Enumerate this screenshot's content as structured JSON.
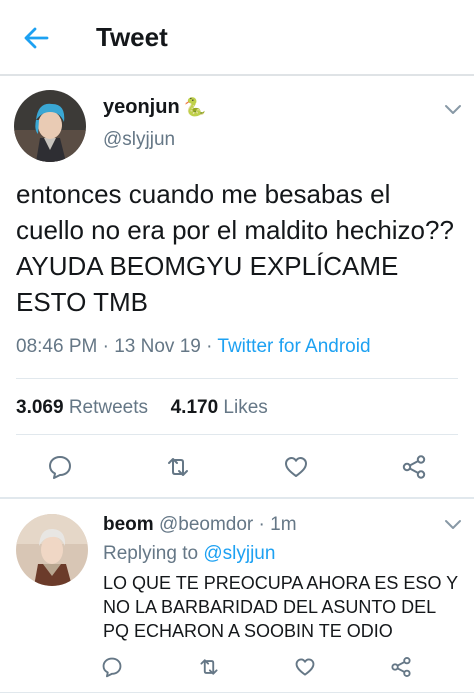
{
  "header": {
    "title": "Tweet"
  },
  "tweet": {
    "display_name": "yeonjun",
    "name_emoji": "🐍",
    "handle": "@slyjjun",
    "text": "entonces cuando me besabas el cuello no era por el maldito hechizo?? AYUDA BEOMGYU EXPLÍCAME ESTO TMB",
    "time": "08:46 PM",
    "date": "13 Nov 19",
    "source": "Twitter for Android",
    "retweets_count": "3.069",
    "retweets_label": "Retweets",
    "likes_count": "4.170",
    "likes_label": "Likes"
  },
  "reply": {
    "display_name": "beom",
    "handle": "@beomdor",
    "time": "1m",
    "replying_label": "Replying to",
    "replying_to": "@slyjjun",
    "text": "LO QUE TE PREOCUPA AHORA ES ESO Y NO LA BARBARIDAD DEL ASUNTO DEL PQ ECHARON A SOOBIN TE ODIO"
  },
  "icons": {
    "back": "arrow-left-icon",
    "more": "chevron-down-icon",
    "reply": "comment-icon",
    "retweet": "retweet-icon",
    "like": "heart-icon",
    "share": "share-icon"
  },
  "colors": {
    "accent": "#1da1f2",
    "secondary_text": "#657786",
    "primary_text": "#14171a",
    "divider": "#e1e8ed"
  }
}
